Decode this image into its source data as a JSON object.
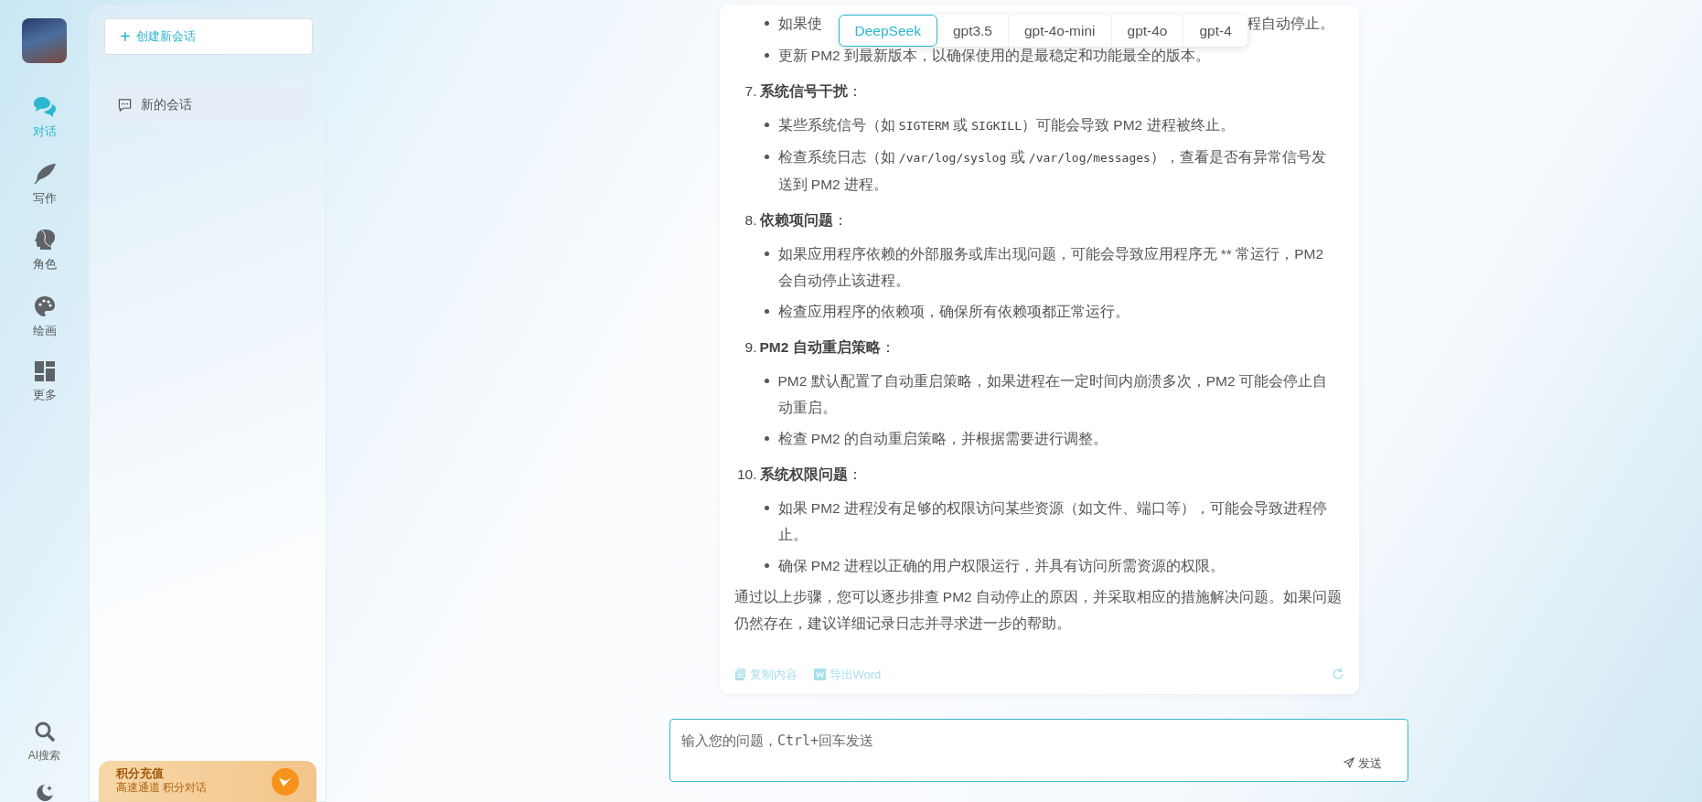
{
  "nav": {
    "items": [
      {
        "label": "对话",
        "selected": true
      },
      {
        "label": "写作",
        "selected": false
      },
      {
        "label": "角色",
        "selected": false
      },
      {
        "label": "绘画",
        "selected": false
      },
      {
        "label": "更多",
        "selected": false
      }
    ],
    "bottom_items": [
      {
        "label": "AI搜索"
      }
    ]
  },
  "sidebar": {
    "new_chat": {
      "icon": "+",
      "label": "创建新会话"
    },
    "conversations": [
      {
        "title": "新的会话"
      }
    ],
    "promo": {
      "title": "积分充值",
      "subtitle": "高速通道 积分对话"
    }
  },
  "model_tabs": [
    {
      "label": "DeepSeek",
      "selected": true
    },
    {
      "label": "gpt3.5",
      "selected": false
    },
    {
      "label": "gpt-4o-mini",
      "selected": false
    },
    {
      "label": "gpt-4o",
      "selected": false
    },
    {
      "label": "gpt-4",
      "selected": false
    }
  ],
  "message": {
    "blocks": [
      {
        "kind": "bullet_occluded",
        "before": "如果使",
        "after": "程自动停止。"
      },
      {
        "kind": "bullet",
        "segments": [
          {
            "text": "更新 PM2 到最新版本，以确保使用的是最稳定和功能最全的版本。"
          }
        ]
      },
      {
        "kind": "heading",
        "number": "7.",
        "title": "**系统信号干扰**："
      },
      {
        "kind": "bullet",
        "segments": [
          {
            "text": "某些系统信号（如 "
          },
          {
            "text": "SIGTERM",
            "code": true
          },
          {
            "text": " 或 "
          },
          {
            "text": "SIGKILL",
            "code": true
          },
          {
            "text": "）可能会导致 PM2 进程被终止。"
          }
        ]
      },
      {
        "kind": "bullet",
        "segments": [
          {
            "text": "检查系统日志（如 "
          },
          {
            "text": "/var/log/syslog",
            "code": true
          },
          {
            "text": " 或 "
          },
          {
            "text": "/var/log/messages",
            "code": true
          },
          {
            "text": "），查看是否有异常信号发送到 PM2 进程。"
          }
        ]
      },
      {
        "kind": "heading",
        "number": "8.",
        "title": "**依赖项问题**："
      },
      {
        "kind": "bullet",
        "segments": [
          {
            "text": "如果应用程序依赖的外部服务或库出现问题，可能会导致应用程序无 ** 常运行，PM2 会自动停止该进程。"
          }
        ]
      },
      {
        "kind": "bullet",
        "segments": [
          {
            "text": "检查应用程序的依赖项，确保所有依赖项都正常运行。"
          }
        ]
      },
      {
        "kind": "heading",
        "number": "9.",
        "title": "**PM2 自动重启策略**："
      },
      {
        "kind": "bullet",
        "segments": [
          {
            "text": "PM2 默认配置了自动重启策略，如果进程在一定时间内崩溃多次，PM2 可能会停止自动重启。"
          }
        ]
      },
      {
        "kind": "bullet",
        "segments": [
          {
            "text": "检查 PM2 的自动重启策略，并根据需要进行调整。"
          }
        ]
      },
      {
        "kind": "heading",
        "number": "10.",
        "title": "**系统权限问题**："
      },
      {
        "kind": "bullet",
        "segments": [
          {
            "text": "如果 PM2 进程没有足够的权限访问某些资源（如文件、端口等），可能会导致进程停止。"
          }
        ]
      },
      {
        "kind": "bullet",
        "segments": [
          {
            "text": "确保 PM2 进程以正确的用户权限运行，并具有访问所需资源的权限。"
          }
        ]
      },
      {
        "kind": "paragraph",
        "text": "通过以上步骤，您可以逐步排查 PM2 自动停止的原因，并采取相应的措施解决问题。如果问题仍然存在，建议详细记录日志并寻求进一步的帮助。"
      }
    ],
    "actions": [
      {
        "kind": "copy",
        "label": "复制内容"
      },
      {
        "kind": "word",
        "label": "导出Word"
      }
    ]
  },
  "input": {
    "placeholder": "输入您的问题，Ctrl+回车发送",
    "send_label": "发送"
  }
}
